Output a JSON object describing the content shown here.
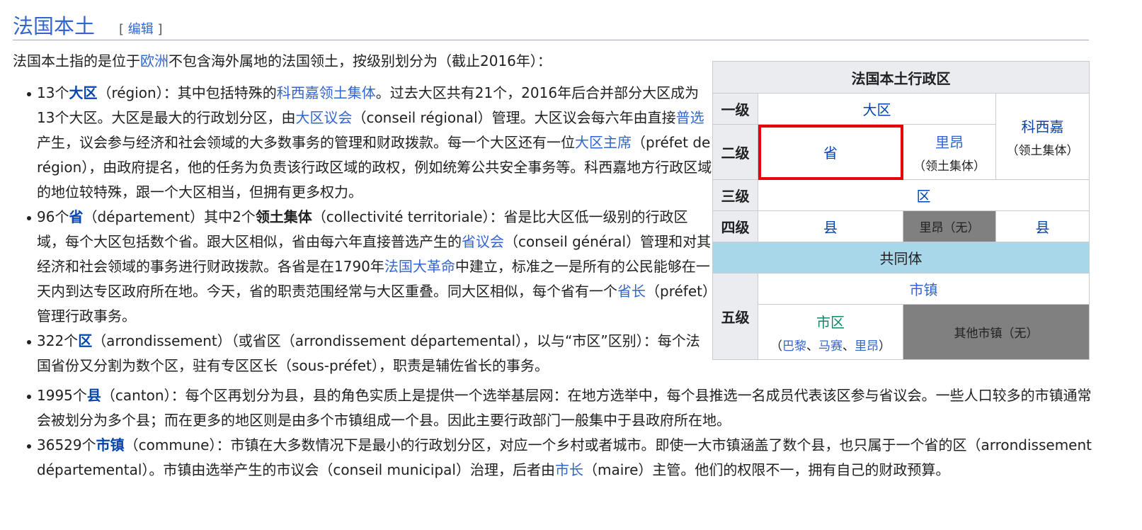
{
  "heading": {
    "title": "法国本土",
    "edit_open": "[",
    "edit_label": "编辑",
    "edit_close": "]"
  },
  "intro": {
    "t1": "法国本土指的是位于",
    "link_europe": "欧洲",
    "t2": "不包含海外属地的法国领土，按级别划分为（截止2016年）："
  },
  "items": {
    "region": {
      "count": "13个",
      "term": "大区",
      "t1": "（région）：其中包括特殊的",
      "link_corsica": "科西嘉领土集体",
      "t2": "。过去大区共有21个，2016年后合并部分大区成为13个大区。大区是最大的行政划分区，由",
      "link_council": "大区议会",
      "t3": "（conseil régional）管理。大区议会每六年由直接",
      "link_election": "普选",
      "t4": "产生，议会参与经济和社会领域的大多数事务的管理和财政拨款。每一个大区还有一位",
      "link_prefect": "大区主席",
      "t5": "（préfet de région），由政府提名，他的任务为负责该行政区域的政权，例如统筹公共安全事务等。科西嘉地方行政区域的地位较特殊，跟一个大区相当，但拥有更多权力。"
    },
    "departement": {
      "count": "96个",
      "term": "省",
      "t1": "（département）其中2个",
      "term2": "领土集体",
      "t2": "（collectivité territoriale）：省是比大区低一级别的行政区域，每个大区包括数个省。跟大区相似，省由每六年直接普选产生的",
      "link_council": "省议会",
      "t3": "（conseil général）管理和对其经济和社会领域的事务进行财政拨款。各省是在1790年",
      "link_revolution": "法国大革命",
      "t4": "中建立，标准之一是所有的公民能够在一天内到达专区政府所在地。今天，省的职责范围经常与大区重叠。同大区相似，每个省有一个",
      "link_prefect": "省长",
      "t5": "（préfet）管理行政事务。"
    },
    "arrondissement": {
      "count": "322个",
      "term": "区",
      "t1": "（arrondissement）（或省区（arrondissement départemental），以与“市区”区别）：每个法国省份又分割为数个区，驻有专区区长（sous-préfet），职责是辅佐省长的事务。"
    },
    "canton": {
      "count": "1995个",
      "term": "县",
      "t1": "（canton）：每个区再划分为县，县的角色实质上是提供一个选举基层网：在地方选举中，每个县推选一名成员代表该区参与省议会。一些人口较多的市镇通常会被划分为多个县；而在更多的地区则是由多个市镇组成一个县。因此主要行政部门一般集中于县政府所在地。"
    },
    "commune": {
      "count": "36529个",
      "term": "市镇",
      "t1": "（commune）：市镇在大多数情况下是最小的行政划分区，对应一个乡村或者城市。即使一大市镇涵盖了数个县，也只属于一个省的区（arrondissement départemental）。市镇由选举产生的市议会（conseil municipal）治理，后者由",
      "link_mayor": "市长",
      "t2": "（maire）主管。他们的权限不一，拥有自己的财政预算。"
    }
  },
  "table": {
    "caption": "法国本土行政区",
    "level1": "一级",
    "level2": "二级",
    "level3": "三级",
    "level4": "四级",
    "level5": "五级",
    "region": "大区",
    "corsica": "科西嘉",
    "corsica_sub": "（领土集体）",
    "departement": "省",
    "lyon": "里昂",
    "lyon_sub": "（领土集体）",
    "arrondissement": "区",
    "canton_left": "县",
    "lyon_none": "里昂（无）",
    "canton_right": "县",
    "intercommunality": "共同体",
    "commune": "市镇",
    "municipal_arr": "市区",
    "open_paren": "（",
    "paris": "巴黎",
    "sep1": "、",
    "marseille": "马赛",
    "sep2": "、",
    "lyon_city": "里昂",
    "close_paren": "）",
    "other_communes": "其他市镇（无）"
  },
  "colors": {
    "link": "#3366cc",
    "header_bg": "#eaecf0",
    "grey_cell": "#808080",
    "intercommunality_bg": "#a7d7e9",
    "highlight": "#e8000b",
    "green_link": "#14866d"
  }
}
